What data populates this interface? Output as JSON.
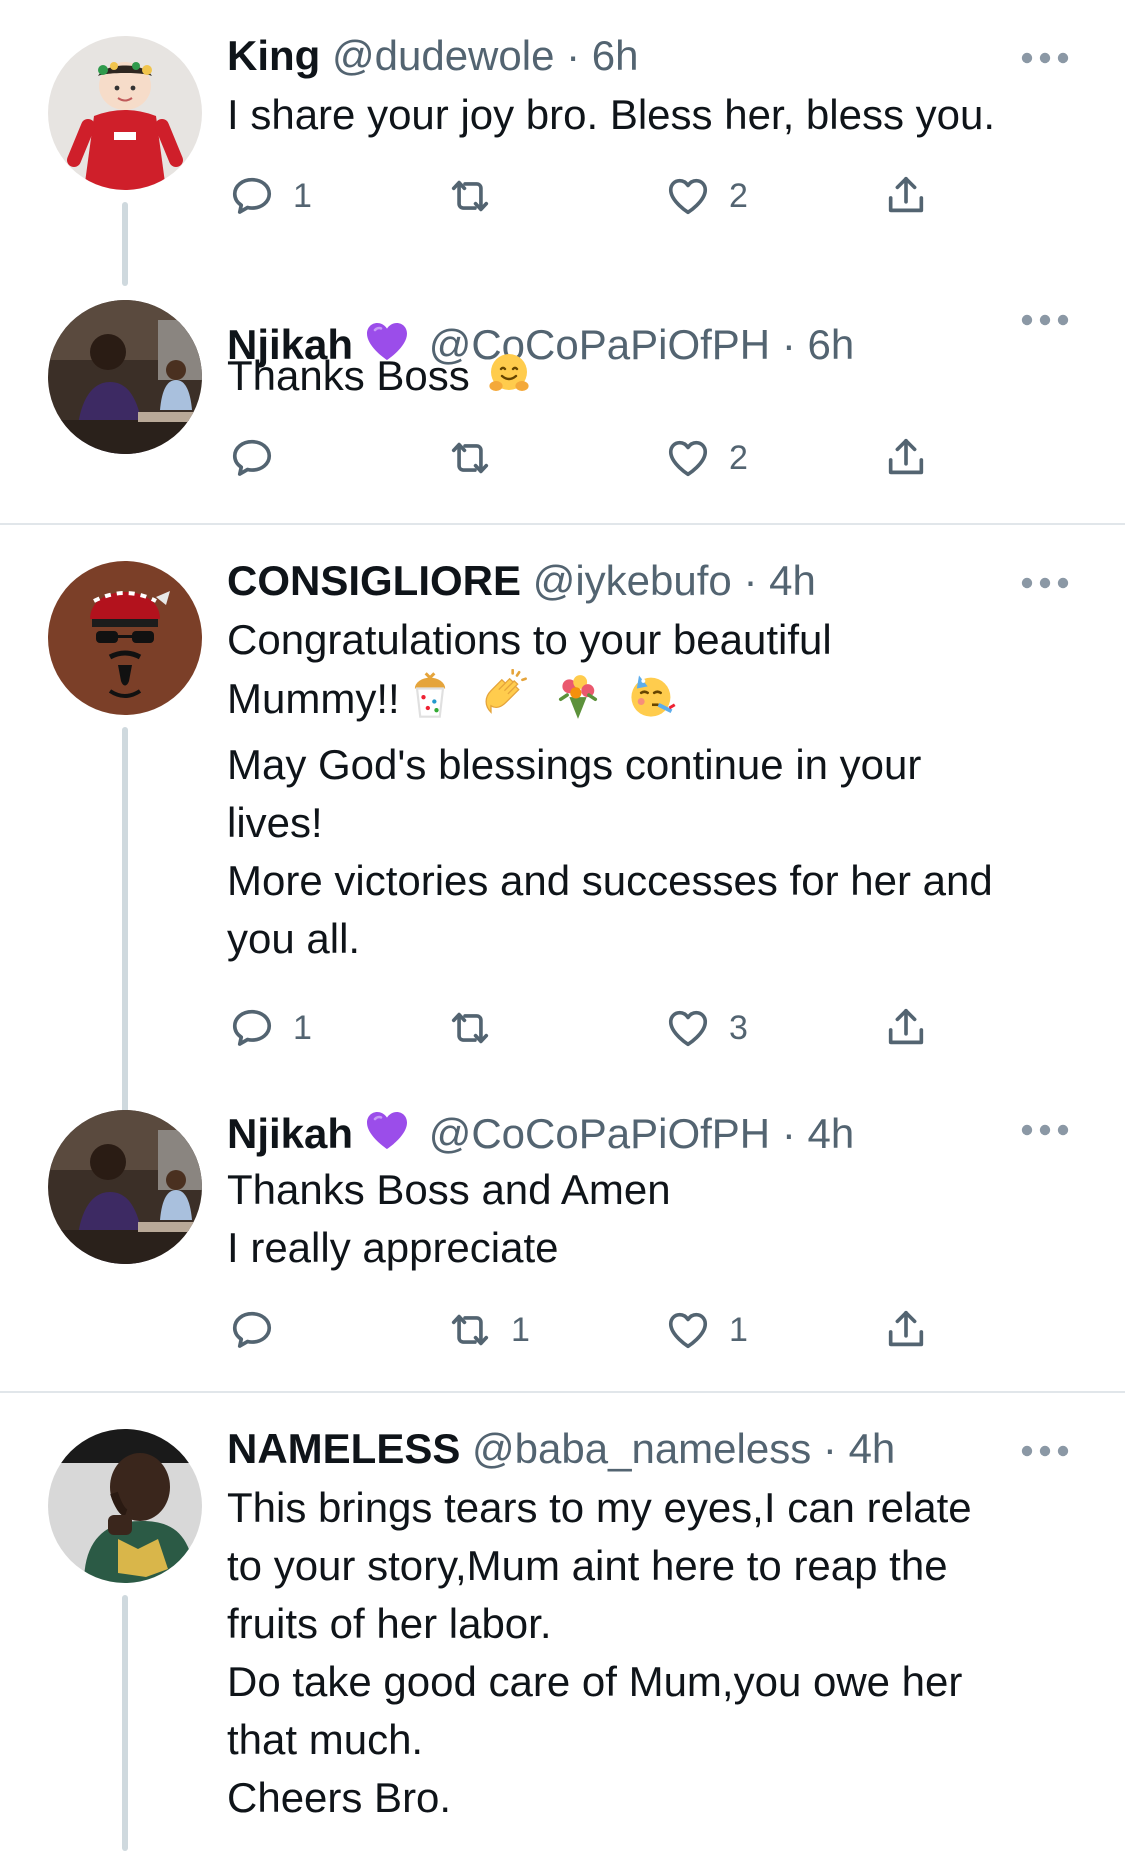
{
  "tweets": [
    {
      "name": "King",
      "handle": "@dudewole",
      "time": "6h",
      "lines": [
        "I share your joy bro. Bless her, bless you."
      ],
      "replies": "1",
      "retweets": "",
      "likes": "2",
      "avatar": "baby-in-red-outfit"
    },
    {
      "name": "Njikah",
      "name_emoji": "purple-heart",
      "handle": "@CoCoPaPiOfPH",
      "time": "6h",
      "lines": [
        "Thanks Boss"
      ],
      "line_emoji": "hugging-face",
      "replies": "",
      "retweets": "",
      "likes": "2",
      "avatar": "man-seated-in-room"
    },
    {
      "name": "CONSIGLIORE",
      "handle": "@iykebufo",
      "time": "4h",
      "lines": [
        "Congratulations to your beautiful",
        "Mummy!!",
        "May God's blessings continue in your",
        "lives!",
        "More victories and successes for her and",
        "you all."
      ],
      "line_emojis": [
        "confetti-ball",
        "clapping-hands",
        "bouquet",
        "partying-face"
      ],
      "replies": "1",
      "retweets": "",
      "likes": "3",
      "avatar": "man-with-hat-and-sunglasses"
    },
    {
      "name": "Njikah",
      "name_emoji": "purple-heart",
      "handle": "@CoCoPaPiOfPH",
      "time": "4h",
      "lines": [
        "Thanks Boss and Amen",
        "I really appreciate"
      ],
      "replies": "",
      "retweets": "1",
      "likes": "1",
      "avatar": "man-seated-in-room"
    },
    {
      "name": "NAMELESS",
      "handle": "@baba_nameless",
      "time": "4h",
      "lines": [
        "This brings tears to my eyes,I can relate",
        "to your story,Mum aint here to reap the",
        "fruits of her labor.",
        "Do take good care of Mum,you owe her",
        "that much.",
        "Cheers Bro."
      ],
      "avatar": "man-in-patterned-shirt"
    }
  ],
  "separator": "·",
  "colors": {
    "text": "#0f1419",
    "secondary": "#536471",
    "thread": "#cfd9de",
    "divider": "#e1e6ea",
    "purple": "#9b4dea"
  }
}
